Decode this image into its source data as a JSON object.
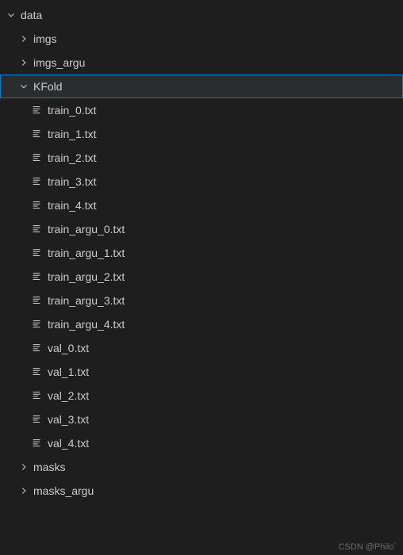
{
  "tree": {
    "root": {
      "name": "data",
      "expanded": true,
      "children": [
        {
          "name": "imgs",
          "type": "folder",
          "expanded": false
        },
        {
          "name": "imgs_argu",
          "type": "folder",
          "expanded": false
        },
        {
          "name": "KFold",
          "type": "folder",
          "expanded": true,
          "selected": true,
          "files": [
            "train_0.txt",
            "train_1.txt",
            "train_2.txt",
            "train_3.txt",
            "train_4.txt",
            "train_argu_0.txt",
            "train_argu_1.txt",
            "train_argu_2.txt",
            "train_argu_3.txt",
            "train_argu_4.txt",
            "val_0.txt",
            "val_1.txt",
            "val_2.txt",
            "val_3.txt",
            "val_4.txt"
          ]
        },
        {
          "name": "masks",
          "type": "folder",
          "expanded": false
        },
        {
          "name": "masks_argu",
          "type": "folder",
          "expanded": false
        }
      ]
    }
  },
  "watermark": "CSDN @Philo`"
}
